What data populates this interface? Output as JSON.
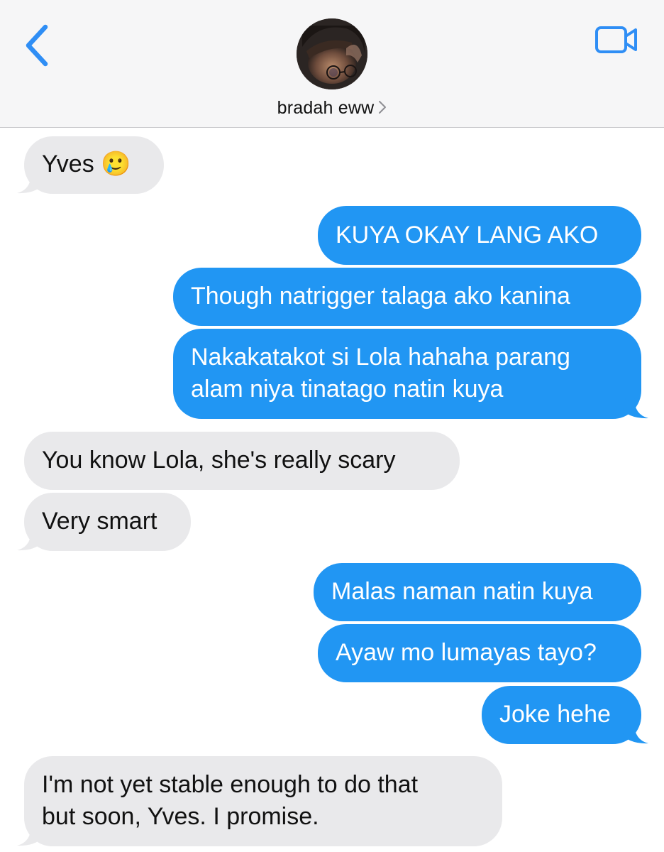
{
  "header": {
    "contact_name": "bradah eww",
    "back_icon": "chevron-left-icon",
    "video_icon": "video-camera-icon",
    "accent_color": "#2f8ef5"
  },
  "messages": [
    {
      "direction": "incoming",
      "lines": [
        "Yves 🥲"
      ]
    },
    {
      "direction": "outgoing",
      "lines": [
        "KUYA OKAY LANG AKO"
      ]
    },
    {
      "direction": "outgoing",
      "lines": [
        "Though natrigger talaga ako kanina"
      ]
    },
    {
      "direction": "outgoing",
      "lines": [
        "Nakakatakot si Lola hahaha parang",
        "alam niya tinatago natin kuya"
      ]
    },
    {
      "direction": "incoming",
      "lines": [
        "You know Lola, she's really scary"
      ]
    },
    {
      "direction": "incoming",
      "lines": [
        "Very smart"
      ]
    },
    {
      "direction": "outgoing",
      "lines": [
        "Malas naman natin kuya"
      ]
    },
    {
      "direction": "outgoing",
      "lines": [
        "Ayaw mo lumayas tayo?"
      ]
    },
    {
      "direction": "outgoing",
      "lines": [
        "Joke hehe"
      ]
    },
    {
      "direction": "incoming",
      "lines": [
        "I'm not yet stable enough to do that",
        "but soon, Yves. I promise."
      ]
    }
  ],
  "colors": {
    "outgoing_bubble": "#2196f3",
    "incoming_bubble": "#e9e9eb",
    "header_bg": "#f6f6f7"
  }
}
